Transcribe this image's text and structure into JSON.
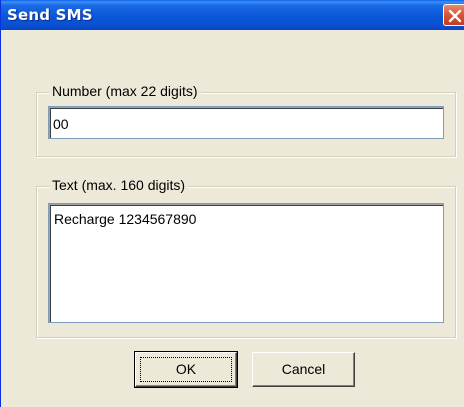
{
  "window": {
    "title": "Send SMS",
    "close_icon": "close-icon"
  },
  "number_group": {
    "legend": "Number (max 22 digits)",
    "value": "00"
  },
  "text_group": {
    "legend": "Text (max. 160 digits)",
    "value": "Recharge 1234567890"
  },
  "buttons": {
    "ok_label": "OK",
    "cancel_label": "Cancel"
  },
  "colors": {
    "titlebar": "#0a56d8",
    "close_button": "#d9573a",
    "dialog_background": "#ece9d8"
  }
}
